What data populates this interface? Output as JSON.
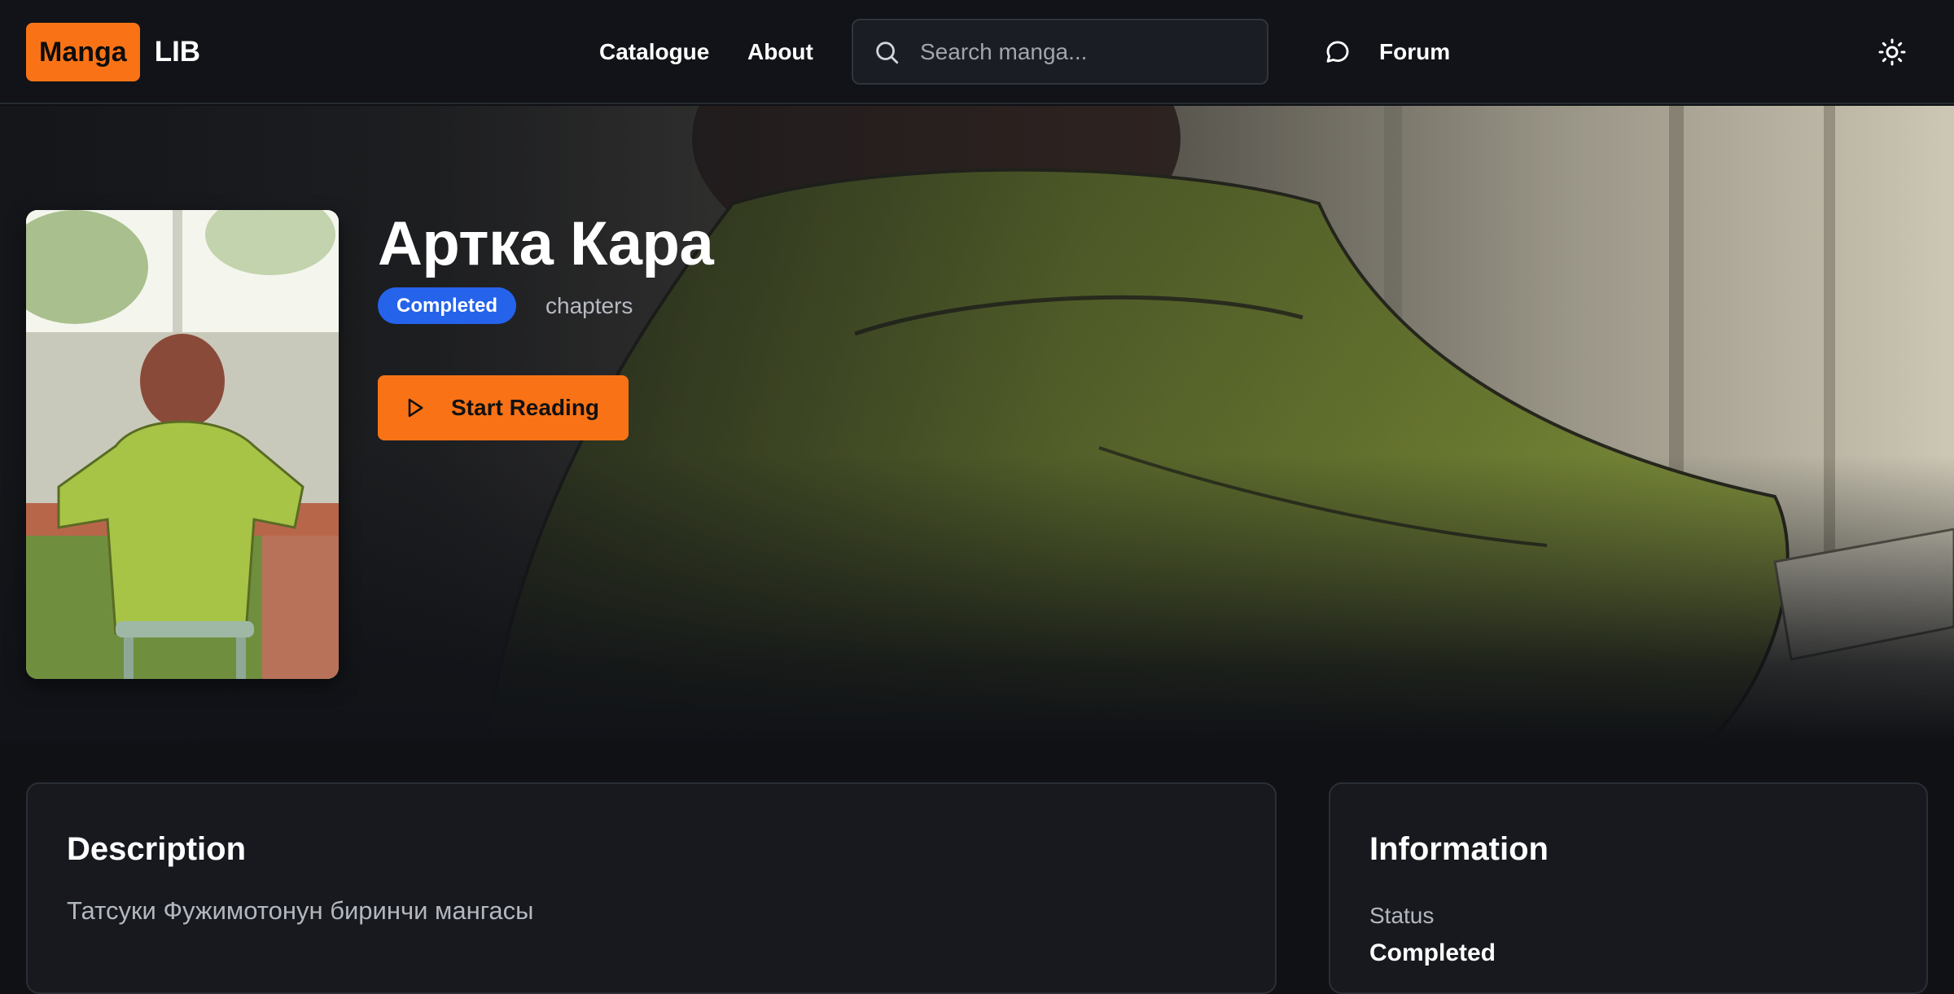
{
  "header": {
    "logo_badge": "Manga",
    "logo_text": "LIB",
    "nav": {
      "catalogue": "Catalogue",
      "about": "About"
    },
    "search": {
      "placeholder": "Search manga...",
      "value": ""
    },
    "forum_label": "Forum",
    "icons": {
      "search": "search-icon",
      "forum": "chat-bubble-icon",
      "theme": "sun-icon"
    }
  },
  "hero": {
    "title": "Артка Кара",
    "status": "Completed",
    "chapters_label": "chapters",
    "start_button_label": "Start Reading",
    "start_button_icon": "play-icon"
  },
  "description": {
    "title": "Description",
    "text": "Татсуки Фужимотонун биринчи мангасы"
  },
  "information": {
    "title": "Information",
    "status_label": "Status",
    "status_value": "Completed"
  },
  "colors": {
    "accent": "#f97316",
    "status_badge": "#2563eb",
    "background": "#0f1115",
    "header": "#111318",
    "card": "#17191e"
  }
}
